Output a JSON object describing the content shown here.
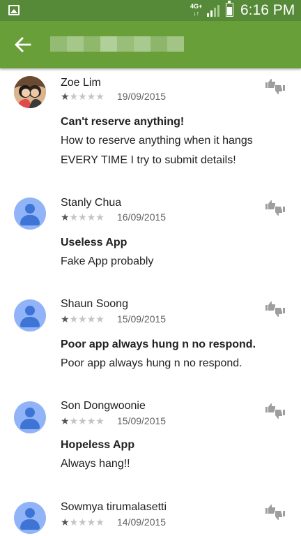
{
  "status_bar": {
    "network_top": "4G+",
    "network_bottom": "↓↑",
    "time": "6:16 PM",
    "icons": [
      "gallery-icon",
      "signal-icon",
      "battery-icon"
    ]
  },
  "app_bar": {
    "back_icon": "arrow-left-icon",
    "title_redacted": true,
    "colors": {
      "status_bar": "#568a38",
      "app_bar": "#689f38"
    }
  },
  "reviews": [
    {
      "name": "Zoe Lim",
      "rating": 1,
      "max_rating": 5,
      "date": "19/09/2015",
      "title": "Can't reserve anything!",
      "body_line1": "How to reserve anything when it hangs",
      "body_line2": "EVERY TIME I try to submit details!",
      "avatar": "photo"
    },
    {
      "name": "Stanly Chua",
      "rating": 1,
      "max_rating": 5,
      "date": "16/09/2015",
      "title": "Useless App",
      "body_line1": "Fake App probably",
      "avatar": "default"
    },
    {
      "name": "Shaun Soong",
      "rating": 1,
      "max_rating": 5,
      "date": "15/09/2015",
      "title": "Poor app always hung n no respond.",
      "body_line1": "Poor app always hung n no respond.",
      "avatar": "default"
    },
    {
      "name": "Son Dongwoonie",
      "rating": 1,
      "max_rating": 5,
      "date": "15/09/2015",
      "title": "Hopeless App",
      "body_line1": "Always hang!!",
      "avatar": "default"
    },
    {
      "name": "Sowmya tirumalasetti",
      "rating": 1,
      "max_rating": 5,
      "date": "14/09/2015",
      "avatar": "default"
    }
  ]
}
